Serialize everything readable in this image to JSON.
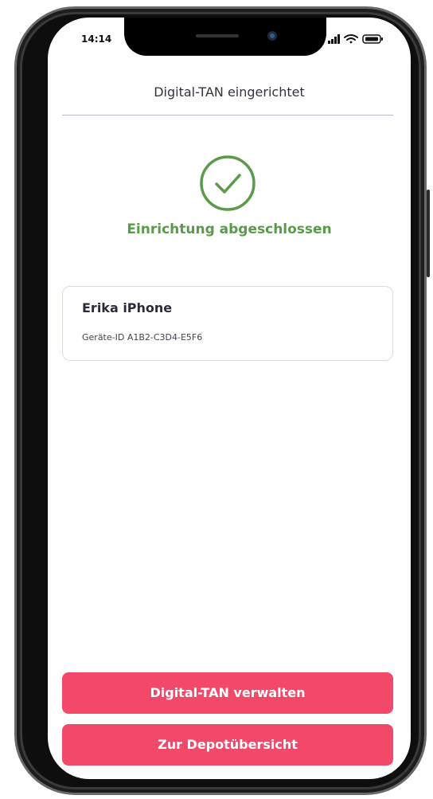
{
  "status_bar": {
    "time": "14:14",
    "icons": [
      "signal-icon",
      "wifi-icon",
      "battery-icon"
    ]
  },
  "header": {
    "title": "Digital-TAN eingerichtet"
  },
  "success": {
    "icon": "checkmark-circle-icon",
    "message": "Einrichtung abgeschlossen"
  },
  "device": {
    "name": "Erika iPhone",
    "id_text": "Geräte-ID A1B2-C3D4-E5F6"
  },
  "actions": {
    "manage_label": "Digital-TAN verwalten",
    "depot_label": "Zur Depotübersicht"
  },
  "colors": {
    "accent": "#f2496a",
    "success": "#5a9a4a",
    "divider": "#b8b8c8"
  }
}
